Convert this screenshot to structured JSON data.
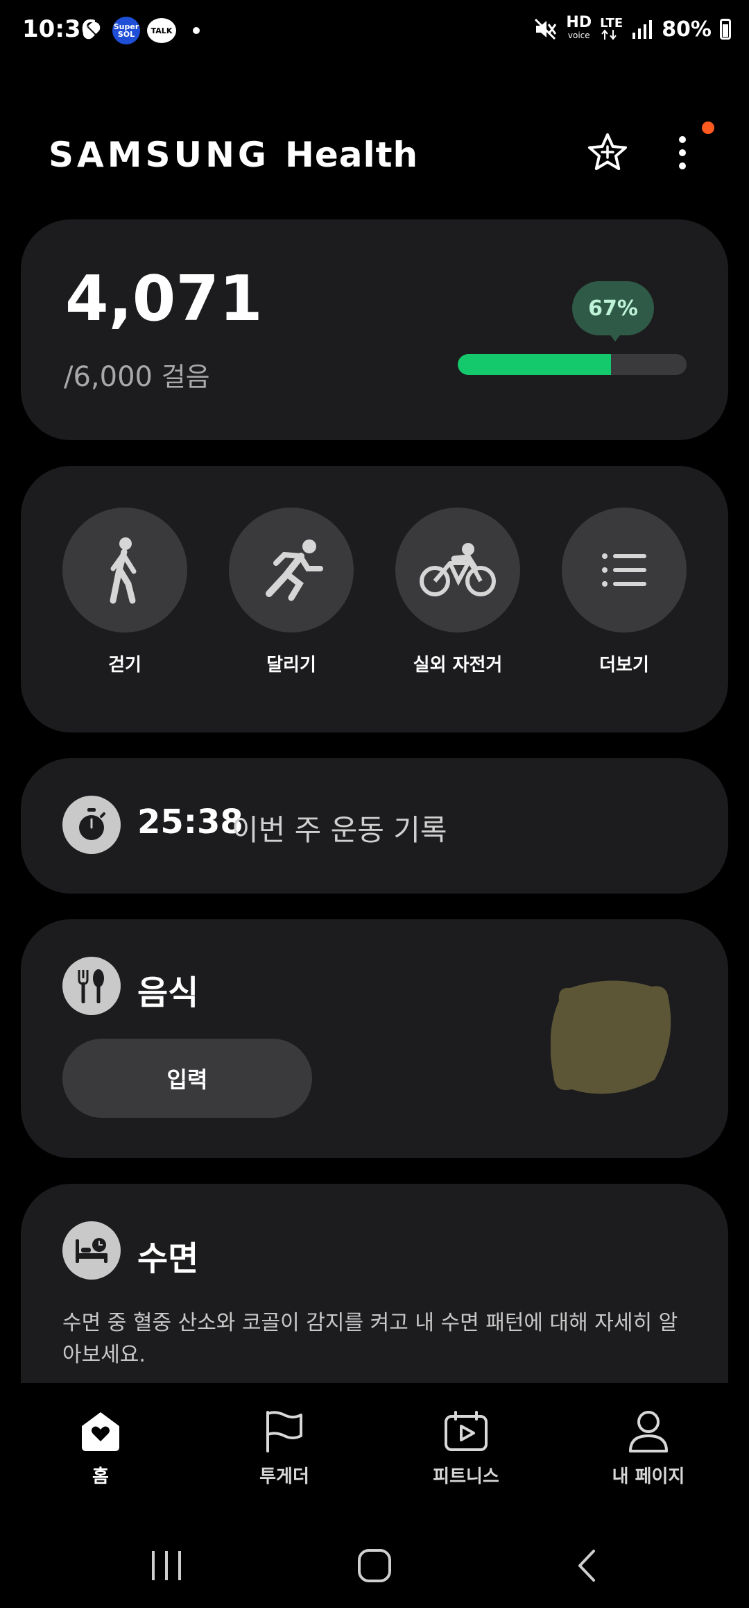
{
  "status_bar": {
    "time": "10:36",
    "sol_icon_text": "Super SOL",
    "talk_icon_text": "TALK",
    "hd_text": "HD",
    "voice_text": "voice",
    "lte_text": "LTE",
    "battery": "80%"
  },
  "header": {
    "brand_samsung": "SAMSUNG",
    "brand_health": "Health",
    "notification_color": "#ff5a1f"
  },
  "steps": {
    "value": "4,071",
    "goal": "/6,000",
    "unit": "걸음",
    "percent_label": "67%",
    "percent": 67,
    "accent": "#14c96c"
  },
  "activities": [
    {
      "label": "걷기",
      "icon": "walking-icon"
    },
    {
      "label": "달리기",
      "icon": "running-icon"
    },
    {
      "label": "실외 자전거",
      "icon": "cycling-icon"
    },
    {
      "label": "더보기",
      "icon": "list-icon"
    }
  ],
  "workout": {
    "time": "25:38",
    "label": "이번 주 운동 기록"
  },
  "food": {
    "title": "음식",
    "button": "입력"
  },
  "sleep": {
    "title": "수면",
    "description": "수면 중 혈중 산소와 코골이 감지를 켜고 내 수면 패턴에 대해 자세히 알아보세요."
  },
  "bottom_nav": [
    {
      "label": "홈",
      "icon": "home-icon",
      "active": true
    },
    {
      "label": "투게더",
      "icon": "flag-icon",
      "active": false
    },
    {
      "label": "피트니스",
      "icon": "fitness-icon",
      "active": false
    },
    {
      "label": "내 페이지",
      "icon": "person-icon",
      "active": false
    }
  ]
}
